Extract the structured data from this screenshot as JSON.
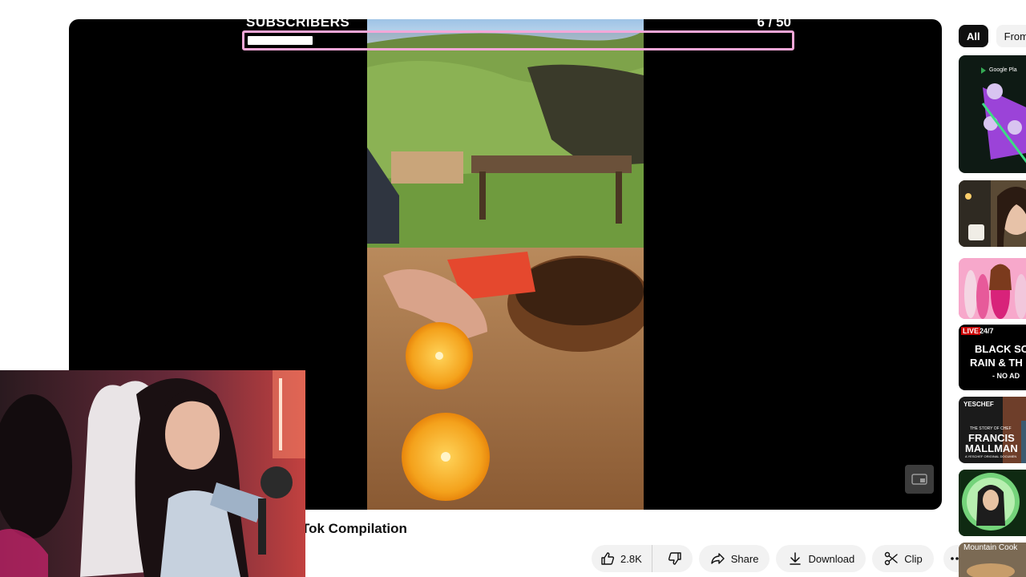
{
  "overlay": {
    "subscribers_label": "SUBSCRIBERS",
    "subscribers_count": "6 / 50",
    "progress_fraction": 0.12
  },
  "video": {
    "title_fragment": "Tok Compilation"
  },
  "actions": {
    "likes": "2.8K",
    "share": "Share",
    "download": "Download",
    "clip": "Clip"
  },
  "sidebar": {
    "chips": [
      "All",
      "From"
    ],
    "thumb1_text": "Google Pla",
    "thumb4_live": "LIVE",
    "thumb4_time": "24/7",
    "thumb4_line1": "BLACK SC",
    "thumb4_line2": "RAIN & TH",
    "thumb4_line3": "- NO AD",
    "thumb5_brand": "YESCHEF",
    "thumb5_small": "THE STORY OF CHEF",
    "thumb5_line1": "FRANCIS",
    "thumb5_line2": "MALLMAN",
    "thumb5_tag": "A YESCHEF ORIGINAL DOCUMEN",
    "thumb7_text": "Mountain Cook"
  },
  "colors": {
    "progress_border": "#f4a7d8",
    "live_badge": "#cc0000",
    "accent_chip": "#0f0f0f"
  }
}
